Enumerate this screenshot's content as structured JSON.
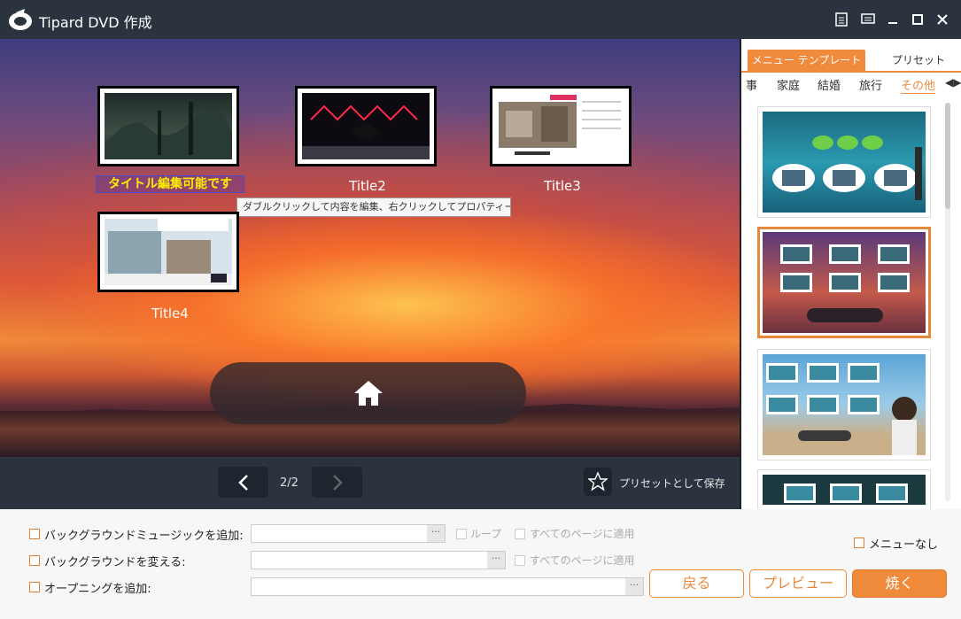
{
  "app": {
    "title": "Tipard DVD 作成"
  },
  "preview": {
    "titles": [
      {
        "label": "タイトル編集可能です",
        "editing": true
      },
      {
        "label": "Title2"
      },
      {
        "label": "Title3"
      },
      {
        "label": "Title4"
      }
    ],
    "tooltip": "ダブルクリックして内容を編集、右クリックしてプロパティーを設"
  },
  "navbar": {
    "page_indicator": "2/2",
    "save_preset_label": "プリセットとして保存"
  },
  "rightpanel": {
    "tabs": [
      {
        "label": "メニュー テンプレート",
        "active": true
      },
      {
        "label": "プリセット"
      }
    ],
    "categories": [
      "事",
      "家庭",
      "結婚",
      "旅行",
      "その他"
    ],
    "active_category": "その他",
    "arrows": "◀▶"
  },
  "bottom": {
    "bg_music_label": "バックグラウンドミュージックを追加:",
    "bg_change_label": "バックグラウンドを変える:",
    "opening_label": "オープニングを追加:",
    "loop_label": "ループ",
    "apply_all_label": "すべてのページに適用",
    "no_menu_label": "メニューなし",
    "dots": "···",
    "back_button": "戻る",
    "preview_button": "プレビュー",
    "burn_button": "焼く"
  },
  "colors": {
    "accent": "#ee8a3a",
    "titlebar": "#2a333e"
  }
}
